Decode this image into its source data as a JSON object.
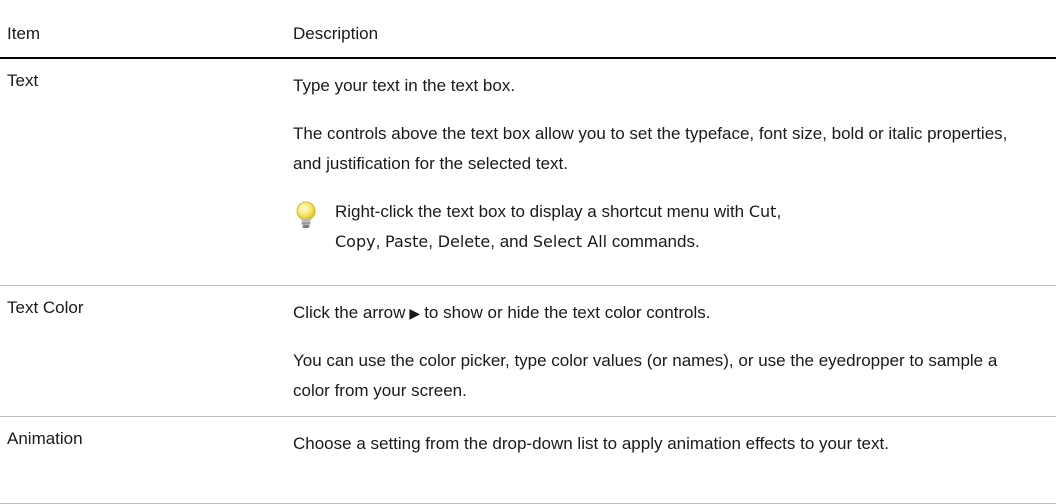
{
  "table": {
    "header": {
      "item": "Item",
      "description": "Description"
    },
    "rows": [
      {
        "item": "Text",
        "p1": "Type your text in the text box.",
        "p2": "The controls above the text box allow you to set the typeface, font size, bold or italic properties, and justification for the selected text.",
        "tip": {
          "icon": "lightbulb-icon",
          "t1": "Right-click the text box to display a shortcut menu with ",
          "cut": "Cut",
          "t2": ",",
          "copy": "Copy",
          "t3": ", ",
          "paste": "Paste",
          "t4": ", ",
          "delete": "Delete",
          "t5": ", and ",
          "select_all": "Select All",
          "t6": " commands."
        }
      },
      {
        "item": "Text Color",
        "p1_a": "Click the arrow",
        "arrow": "▶",
        "p1_b": "to show or hide the text color controls.",
        "p2": "You can use the color picker, type color values (or names), or use the eyedropper to sample a color from your screen."
      },
      {
        "item": "Animation",
        "p1": "Choose a setting from the drop-down list to apply animation effects to your text."
      }
    ]
  }
}
